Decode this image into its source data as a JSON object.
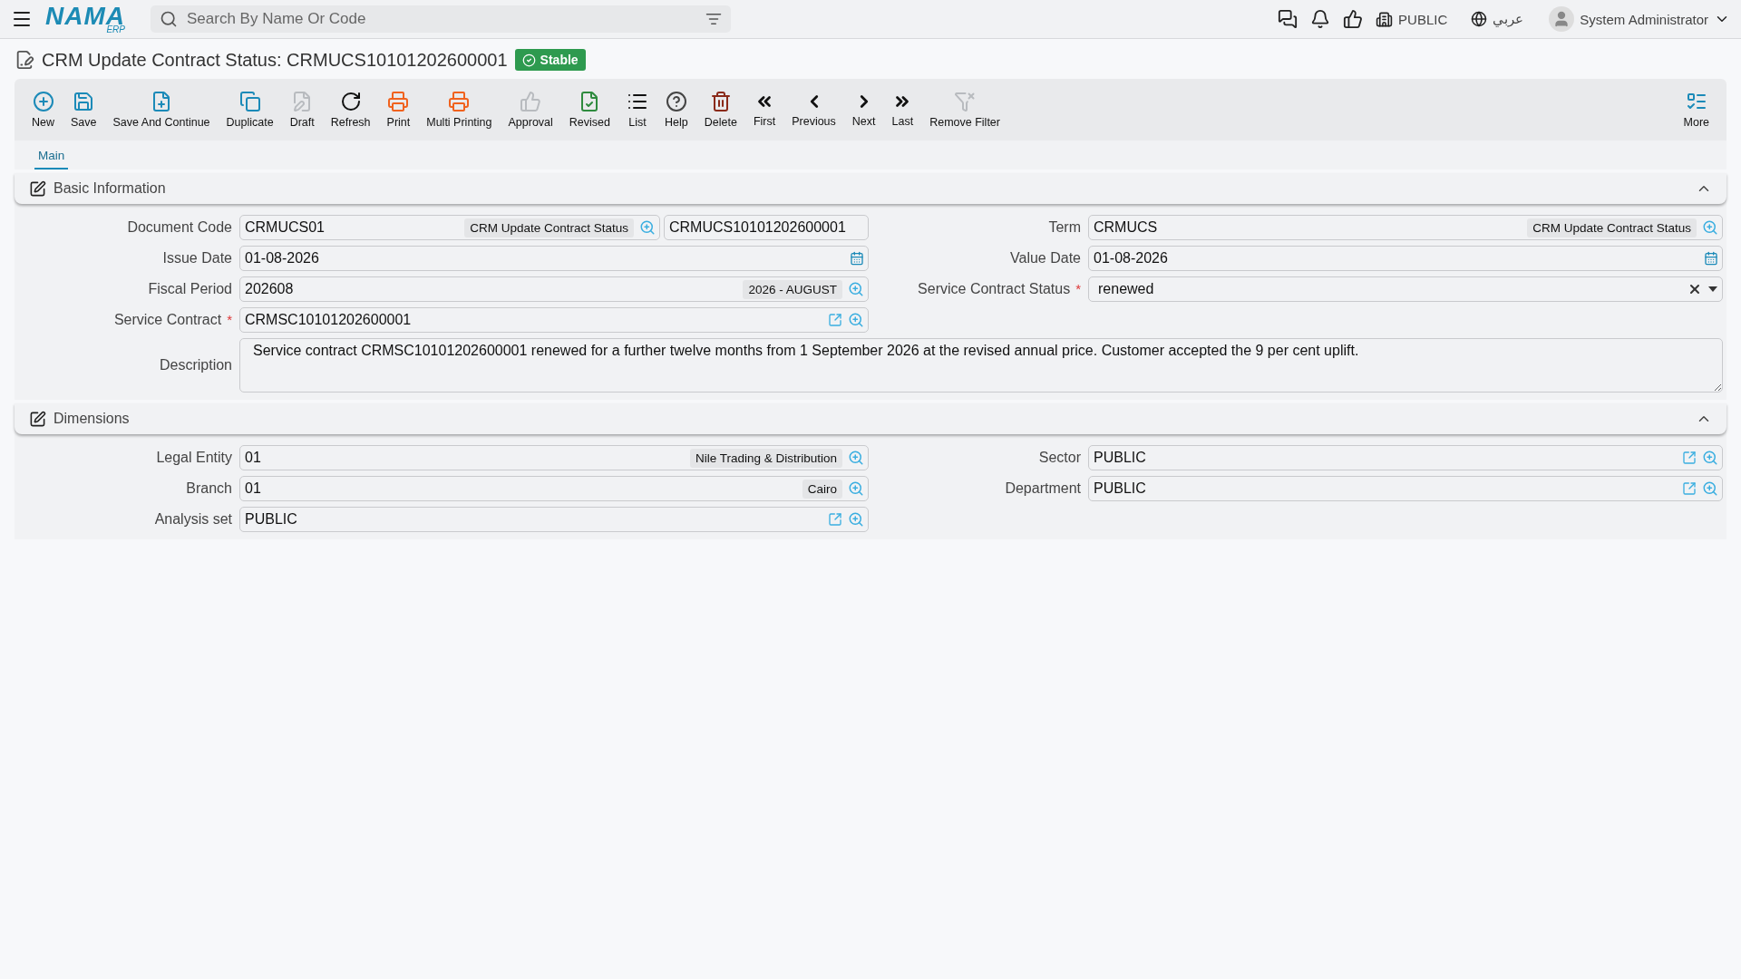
{
  "topbar": {
    "logo": "NAMA",
    "logo_sub": "ERP",
    "search": {
      "placeholder": "Search By Name Or Code"
    },
    "company": "PUBLIC",
    "language": "عربي",
    "user": "System Administrator"
  },
  "title": "CRM Update Contract Status: CRMUCS10101202600001",
  "status": {
    "label": "Stable",
    "color": "#2e9a4f"
  },
  "toolbar": [
    {
      "label": "New",
      "color": "#1b8ab8"
    },
    {
      "label": "Save",
      "color": "#1b8ab8"
    },
    {
      "label": "Save And Continue",
      "color": "#1b8ab8"
    },
    {
      "label": "Duplicate",
      "color": "#1b8ab8"
    },
    {
      "label": "Draft",
      "color": "#b8bbbf"
    },
    {
      "label": "Refresh",
      "color": "#111111"
    },
    {
      "label": "Print",
      "color": "#f0621e"
    },
    {
      "label": "Multi Printing",
      "color": "#f0621e"
    },
    {
      "label": "Approval",
      "color": "#b8bbbf"
    },
    {
      "label": "Revised",
      "color": "#2e8b3e"
    },
    {
      "label": "List",
      "color": "#111111"
    },
    {
      "label": "Help",
      "color": "#444444"
    },
    {
      "label": "Delete",
      "color": "#8a2a1a"
    },
    {
      "label": "First",
      "color": "#111111"
    },
    {
      "label": "Previous",
      "color": "#111111"
    },
    {
      "label": "Next",
      "color": "#111111"
    },
    {
      "label": "Last",
      "color": "#111111"
    },
    {
      "label": "Remove Filter",
      "color": "#b8bbbf"
    }
  ],
  "more": {
    "label": "More"
  },
  "tabs": [
    {
      "label": "Main",
      "selected": true
    }
  ],
  "sections": [
    {
      "title": "Basic Information",
      "expanded": true,
      "left": [
        {
          "label": "Document Code",
          "kind": "lookup",
          "value": "CRMUCS01",
          "tag": "CRM Update Contract Status",
          "second_value": "CRMUCS10101202600001",
          "open_link": false
        },
        {
          "label": "Issue Date",
          "kind": "date",
          "value": "01-08-2026"
        },
        {
          "label": "Fiscal Period",
          "kind": "lookup",
          "value": "202608",
          "tag": "2026 - AUGUST",
          "open_link": false
        },
        {
          "label": "Service Contract",
          "kind": "lookup",
          "value": "CRMSC10101202600001",
          "required_mark": "*",
          "open_link": true
        }
      ],
      "right": [
        {
          "label": "Term",
          "kind": "lookup",
          "value": "CRMUCS",
          "tag": "CRM Update Contract Status",
          "open_link": false
        },
        {
          "label": "Value Date",
          "kind": "date",
          "value": "01-08-2026"
        },
        {
          "label": "Service Contract Status",
          "kind": "select",
          "value": "renewed",
          "required_mark": "*"
        }
      ],
      "full": [
        {
          "label": "Description",
          "kind": "textarea",
          "value": "Service contract CRMSC10101202600001 renewed for a further twelve months from 1 September 2026 at the revised annual price. Customer accepted the 9 per cent uplift."
        }
      ]
    },
    {
      "title": "Dimensions",
      "expanded": true,
      "left": [
        {
          "label": "Legal Entity",
          "kind": "lookup",
          "value": "01",
          "tag": "Nile Trading & Distribution",
          "open_link": false
        },
        {
          "label": "Branch",
          "kind": "lookup",
          "value": "01",
          "tag": "Cairo",
          "open_link": false
        },
        {
          "label": "Analysis set",
          "kind": "lookup",
          "value": "PUBLIC",
          "open_link": true
        }
      ],
      "right": [
        {
          "label": "Sector",
          "kind": "lookup",
          "value": "PUBLIC",
          "open_link": true
        },
        {
          "label": "Department",
          "kind": "lookup",
          "value": "PUBLIC",
          "open_link": true
        }
      ]
    }
  ]
}
